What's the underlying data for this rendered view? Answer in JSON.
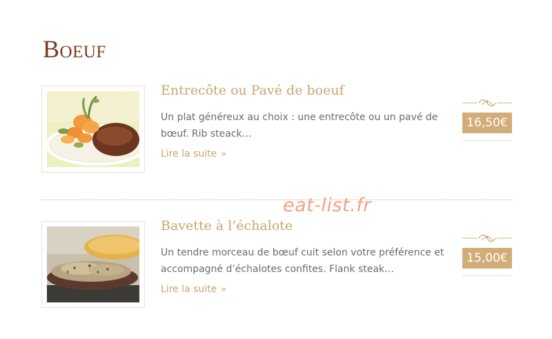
{
  "section": {
    "title": "Boeuf"
  },
  "items": [
    {
      "title": "Entrecôte ou Pavé de boeuf",
      "description": "Un plat généreux au choix : une entrecôte ou un pavé de bœuf. Rib steack…",
      "read_more": "Lire la suite",
      "read_more_icon": "double-chevron-right-icon",
      "price": "16,50€",
      "image_alt": "steak-with-carrots-photo"
    },
    {
      "title": "Bavette à l’échalote",
      "description": "Un tendre morceau de bœuf cuit selon votre préférence et accompagné d’échalotes confites. Flank steak…",
      "read_more": "Lire la suite",
      "read_more_icon": "double-chevron-right-icon",
      "price": "15,00€",
      "image_alt": "flank-steak-with-shallots-photo"
    }
  ],
  "watermark": "eat-list.fr",
  "colors": {
    "heading": "#7a3b20",
    "accent": "#c9a56f",
    "price_bg": "#d2ad78",
    "text": "#6b6b6b",
    "watermark": "#f2a283"
  }
}
